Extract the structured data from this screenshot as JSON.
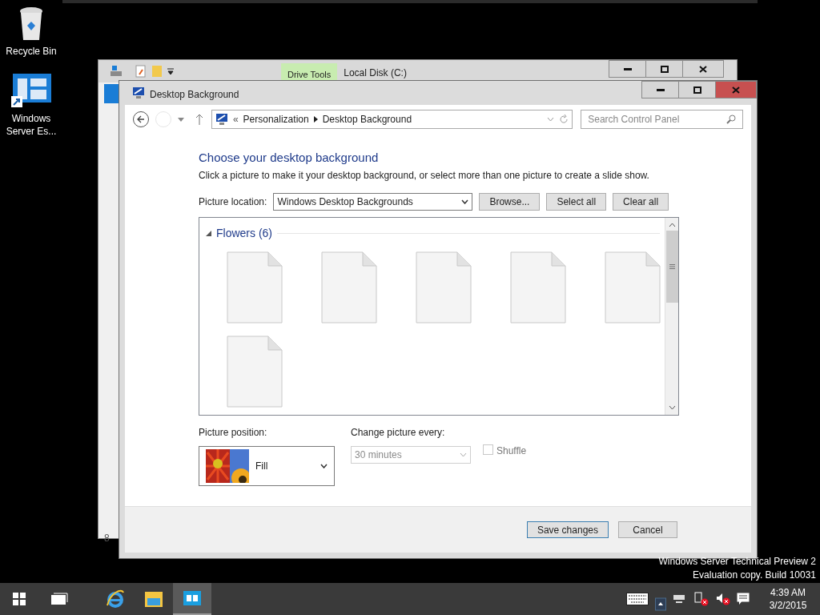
{
  "desktop_icons": [
    {
      "label": "Recycle Bin",
      "kind": "recycle-bin"
    },
    {
      "label": "Windows Server Es...",
      "kind": "shortcut"
    }
  ],
  "back_window": {
    "ribbon_tab": "Drive Tools",
    "title": "Local Disk (C:)",
    "status_fragment": "8"
  },
  "window": {
    "title": "Desktop Background",
    "breadcrumb_overflow": "«",
    "breadcrumb": [
      "Personalization",
      "Desktop Background"
    ],
    "search_placeholder": "Search Control Panel",
    "heading": "Choose your desktop background",
    "description": "Click a picture to make it your desktop background, or select more than one picture to create a slide show.",
    "location_label": "Picture location:",
    "location_value": "Windows Desktop Backgrounds",
    "buttons": [
      "Browse...",
      "Select all",
      "Clear all"
    ],
    "groups": [
      {
        "name": "Flowers (6)",
        "expanded": true,
        "items": [
          {
            "selected": false
          },
          {
            "selected": false
          },
          {
            "selected": false
          },
          {
            "selected": false
          },
          {
            "selected": false
          },
          {
            "selected": false
          }
        ]
      }
    ],
    "position": {
      "label": "Picture position:",
      "value": "Fill"
    },
    "interval": {
      "label": "Change picture every:",
      "value": "30 minutes",
      "disabled": true
    },
    "shuffle": {
      "label": "Shuffle",
      "checked": false,
      "disabled": true
    },
    "footer_buttons": [
      {
        "label": "Save changes",
        "default": true
      },
      {
        "label": "Cancel",
        "default": false
      }
    ]
  },
  "build_info": [
    "Windows Server Technical Preview 2",
    "Evaluation copy. Build 10031"
  ],
  "taskbar": {
    "apps": [
      {
        "kind": "ie",
        "active": false
      },
      {
        "kind": "explorer",
        "active": false
      },
      {
        "kind": "control-panel",
        "active": true
      }
    ],
    "time": "4:39 AM",
    "date": "3/2/2015"
  }
}
